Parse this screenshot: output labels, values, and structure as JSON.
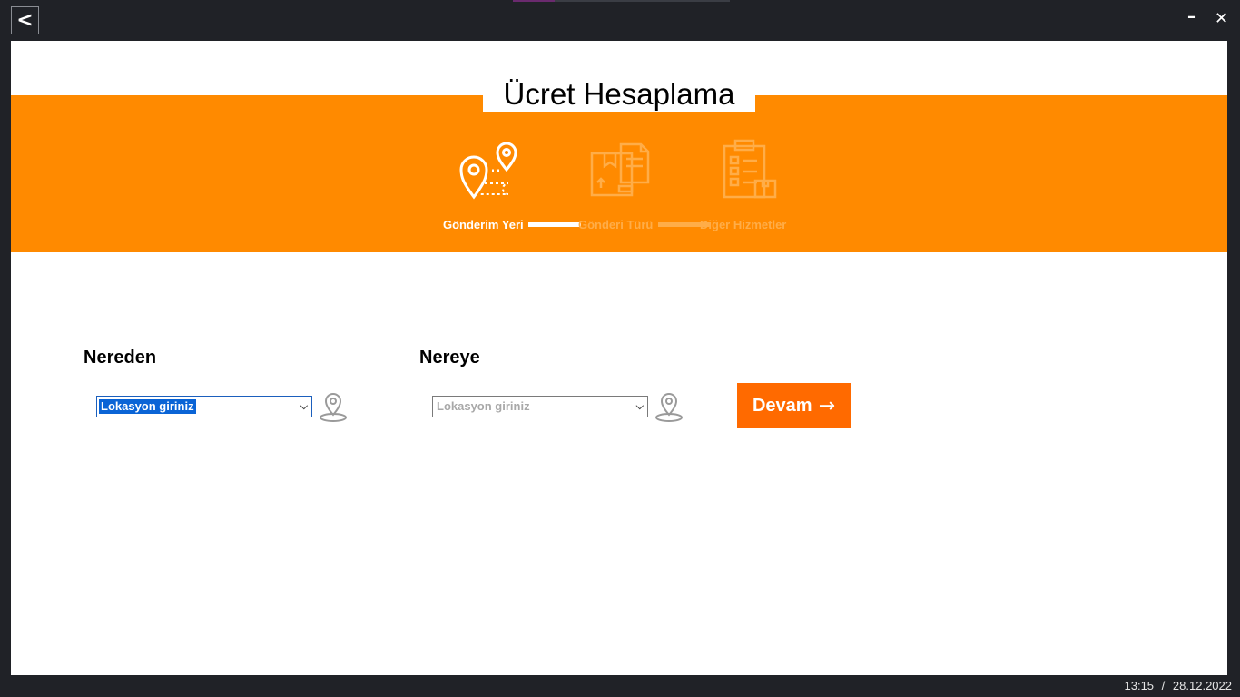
{
  "window": {
    "back_label": "<",
    "minimize_label": "–",
    "close_label": "✕"
  },
  "page": {
    "title": "Ücret Hesaplama"
  },
  "steps": [
    {
      "label": "Gönderim Yeri",
      "state": "active",
      "icon": "route-location-icon"
    },
    {
      "label": "Gönderi Türü",
      "state": "inactive",
      "icon": "package-document-icon"
    },
    {
      "label": "Diğer Hizmetler",
      "state": "inactive",
      "icon": "clipboard-checklist-icon"
    }
  ],
  "form": {
    "from": {
      "label": "Nereden",
      "value": "Lokasyon giriniz",
      "pin_icon": "location-pin-icon"
    },
    "to": {
      "label": "Nereye",
      "value": "Lokasyon giriniz",
      "pin_icon": "location-pin-icon"
    },
    "continue_label": "Devam",
    "continue_arrow": "→"
  },
  "status": {
    "time": "13:15",
    "separator": "/",
    "date": "28.12.2022"
  },
  "colors": {
    "banner": "#ff8a00",
    "button": "#ff6a00",
    "frame": "#202227",
    "inactive_step": "#ffad48"
  }
}
